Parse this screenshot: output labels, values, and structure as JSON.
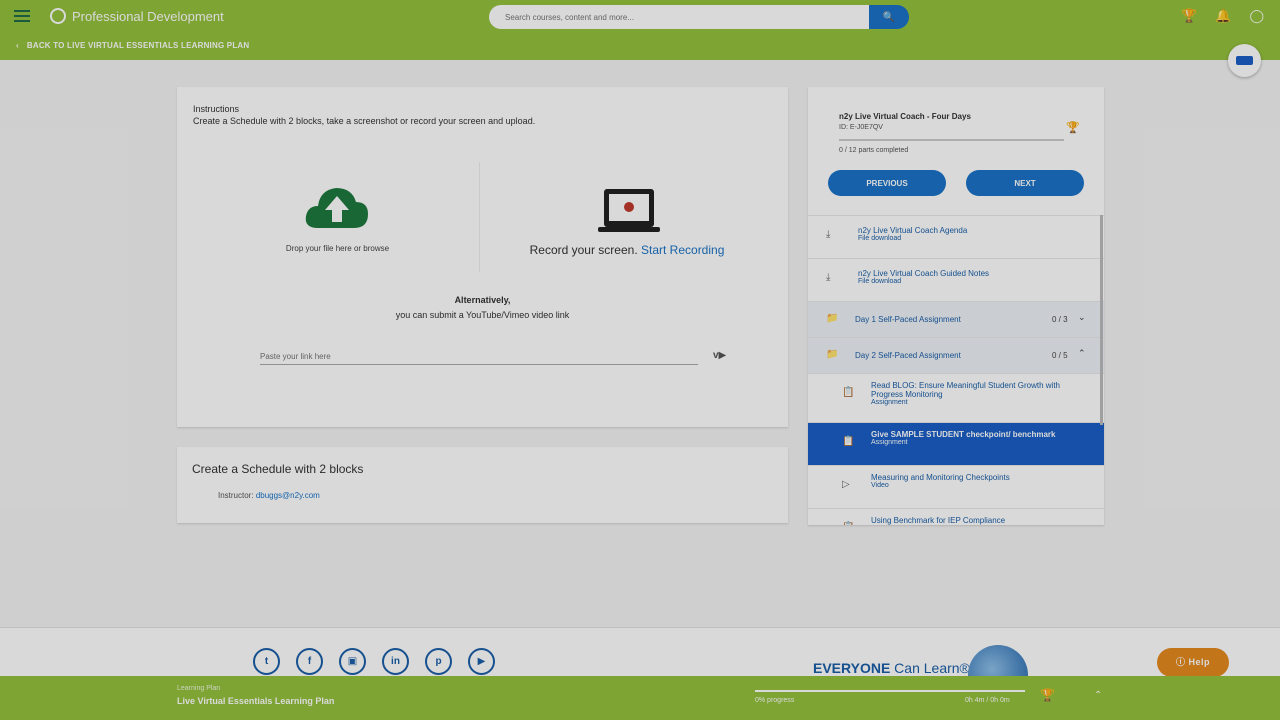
{
  "header": {
    "brand": "Professional Development",
    "search_placeholder": "Search courses, content and more...",
    "back_link": "BACK TO LIVE VIRTUAL ESSENTIALS LEARNING PLAN",
    "icons": [
      "menu-icon",
      "search-icon",
      "trophy-icon",
      "bell-icon",
      "user-icon",
      "chat-icon"
    ]
  },
  "instructions": {
    "heading": "Instructions",
    "text": "Create a Schedule with 2 blocks, take a screenshot or record your screen and upload.",
    "drop_label": "Drop your file here or browse",
    "record_text": "Record your screen.",
    "record_link": "Start Recording",
    "alt_heading": "Alternatively,",
    "alt_text": "you can submit a YouTube/Vimeo video link",
    "link_placeholder": "Paste your link here"
  },
  "schedule": {
    "title": "Create a Schedule with 2 blocks",
    "instructor_label": "Instructor:",
    "instructor_email": "dbuggs@n2y.com"
  },
  "panel": {
    "title": "n2y Live Virtual Coach - Four Days",
    "id": "ID: E-J0E7QV",
    "parts": "0 / 12 parts completed",
    "progress": 0,
    "prev_label": "PREVIOUS",
    "next_label": "NEXT",
    "items": [
      {
        "title": "n2y Live Virtual Coach Agenda",
        "sub": "File download"
      },
      {
        "title": "n2y Live Virtual Coach Guided Notes",
        "sub": "File download"
      }
    ],
    "folders": [
      {
        "title": "Day 1 Self-Paced Assignment",
        "count": "0 / 3"
      },
      {
        "title": "Day 2 Self-Paced Assignment",
        "count": "0 / 5"
      }
    ],
    "sub_items": [
      {
        "title": "Read BLOG: Ensure Meaningful Student Growth with Progress Monitoring",
        "sub": "Assignment"
      },
      {
        "title": "Give SAMPLE STUDENT checkpoint/ benchmark",
        "sub": "Assignment"
      },
      {
        "title": "Measuring and Monitoring Checkpoints",
        "sub": "Video"
      },
      {
        "title": "Using Benchmark for IEP Compliance",
        "sub": ""
      }
    ]
  },
  "footer": {
    "socials": [
      "twitter-icon",
      "facebook-icon",
      "instagram-icon",
      "linkedin-icon",
      "pinterest-icon",
      "youtube-icon"
    ],
    "tagline_bold": "EVERYONE",
    "tagline_rest": "Can Learn®",
    "help_label": "Help"
  },
  "bottom_bar": {
    "label": "Learning Plan",
    "name": "Live Virtual Essentials Learning Plan",
    "progress_text": "0% progress",
    "progress": 0,
    "time": "0h 4m / 0h 0m"
  }
}
